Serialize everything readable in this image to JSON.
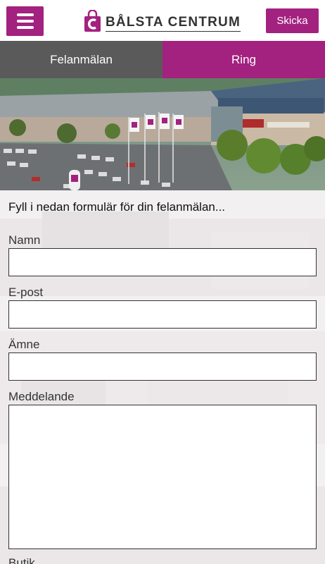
{
  "header": {
    "logo_text": "BÅLSTA CENTRUM",
    "send_label": "Skicka"
  },
  "tabs": [
    {
      "label": "Felanmälan"
    },
    {
      "label": "Ring"
    }
  ],
  "form": {
    "intro": "Fyll i nedan formulär för din felanmälan...",
    "fields": [
      {
        "label": "Namn",
        "value": ""
      },
      {
        "label": "E-post",
        "value": ""
      },
      {
        "label": "Ämne",
        "value": ""
      },
      {
        "label": "Meddelande",
        "value": ""
      },
      {
        "label": "Butik"
      }
    ]
  },
  "colors": {
    "accent": "#a3217f",
    "tab_inactive": "#5a5a5a"
  }
}
